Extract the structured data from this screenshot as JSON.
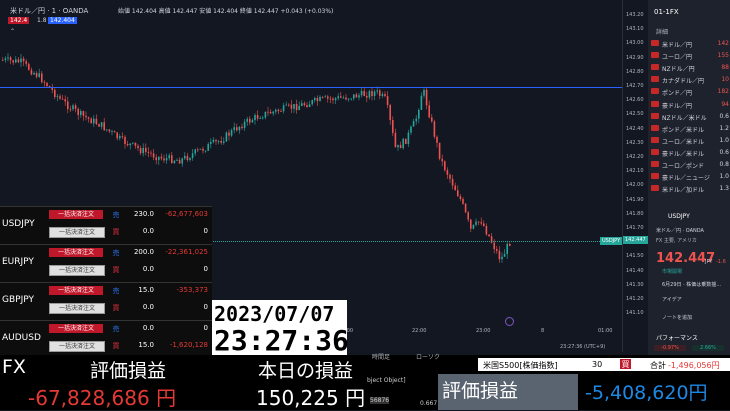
{
  "topbar": {
    "symbol": "米ドル／円 · 1 · OANDA",
    "sell_price": "142.4",
    "spread": "1.8",
    "buy_price": "142.404",
    "ohlc": "始値 142.404  高値 142.447  安値 142.404  終値 142.447 +0.043 (+0.03%)"
  },
  "yaxis_ticks": [
    "143.20",
    "143.10",
    "143.00",
    "142.90",
    "142.80",
    "142.70",
    "142.60",
    "142.50",
    "142.40",
    "142.30",
    "142.20",
    "142.10",
    "142.00",
    "141.90",
    "141.80",
    "141.70",
    "141.60",
    "141.50",
    "141.40",
    "141.30",
    "141.20",
    "141.10"
  ],
  "price_label": {
    "symbol": "USDJPY",
    "price": "142.447"
  },
  "xaxis_ticks": [
    ":00",
    "22:00",
    "23:00",
    "8",
    "01:00"
  ],
  "timezone": "23:27:36 (UTC+9)",
  "watchlist": {
    "header": "01-1FX",
    "col": "詳細",
    "items": [
      {
        "name": "米ドル／円",
        "val": "142"
      },
      {
        "name": "ユーロ／円",
        "val": "155"
      },
      {
        "name": "NZドル／円",
        "val": "88"
      },
      {
        "name": "カナダドル／円",
        "val": "10"
      },
      {
        "name": "ポンド／円",
        "val": "182"
      },
      {
        "name": "豪ドル／円",
        "val": "94"
      },
      {
        "name": "NZドル／米ドル",
        "val": "0.6"
      },
      {
        "name": "ポンド／米ドル",
        "val": "1.2"
      },
      {
        "name": "ユーロ／米ドル",
        "val": "1.0"
      },
      {
        "name": "豪ドル／米ドル",
        "val": "0.6"
      },
      {
        "name": "ユーロ／ポンド",
        "val": "0.8"
      },
      {
        "name": "豪ドル／ニュージ",
        "val": "1.0"
      },
      {
        "name": "米ドル／加ドル",
        "val": "1.3"
      }
    ],
    "detail_symbol": "USDJPY",
    "detail_name": "米ドル／円 · OANDA",
    "detail_sub": "FX 主要, アメリカ",
    "detail_price": "142.447",
    "detail_unit": "JPY",
    "detail_change": "-1.6",
    "market_status": "市場開場",
    "news": "6月29日 · 株価は乗数揺...",
    "idea_btn": "アイデア",
    "note_btn": "ノートを追加",
    "performance": "パフォーマンス",
    "perf1": "-0.97%",
    "perf2": "2.66%"
  },
  "positions": [
    {
      "symbol": "USDJPY",
      "close_all": "一括決済注文",
      "cancel": "一括決済注文",
      "rows": [
        {
          "side": "売",
          "qty": "230.0",
          "pnl": "-62,677,603"
        },
        {
          "side": "買",
          "qty": "0.0",
          "pnl": "0"
        }
      ]
    },
    {
      "symbol": "EURJPY",
      "close_all": "一括決済注文",
      "cancel": "一括決済注文",
      "rows": [
        {
          "side": "売",
          "qty": "200.0",
          "pnl": "-22,361,025"
        },
        {
          "side": "買",
          "qty": "0.0",
          "pnl": "0"
        }
      ]
    },
    {
      "symbol": "GBPJPY",
      "close_all": "一括決済注文",
      "cancel": "一括決済注文",
      "rows": [
        {
          "side": "売",
          "qty": "15.0",
          "pnl": "-353,373"
        },
        {
          "side": "買",
          "qty": "0.0",
          "pnl": "0"
        }
      ]
    },
    {
      "symbol": "AUDUSD",
      "close_all": "一括決済注文",
      "cancel": "一括決済注文",
      "rows": [
        {
          "side": "売",
          "qty": "0.0",
          "pnl": "0"
        },
        {
          "side": "買",
          "qty": "15.0",
          "pnl": "-1,620,128"
        }
      ]
    }
  ],
  "datetime": {
    "date": "2023/07/07",
    "time": "23:27:36"
  },
  "bottom": {
    "fx_label": "FX",
    "pnl_label": "評価損益",
    "fx_pnl": "-67,828,686 円",
    "today_label": "本日の損益",
    "today_pnl": "150,225 円",
    "sp_label": "米国S500[株価指数]",
    "sp_qty": "30",
    "sp_side": "買",
    "total_label": "合計",
    "total_val": "-1,496,056円",
    "sp_pnl_label": "評価損益",
    "sp_pnl": "-5,408,620円",
    "obj_text": "bject Object]",
    "small1": "56876",
    "small2": "0.667",
    "tab1": "時間足",
    "tab2": "ローソク"
  },
  "colors": {
    "up": "#26a69a",
    "down": "#ef5350",
    "accent": "#c0182b",
    "bg": "#131722"
  }
}
